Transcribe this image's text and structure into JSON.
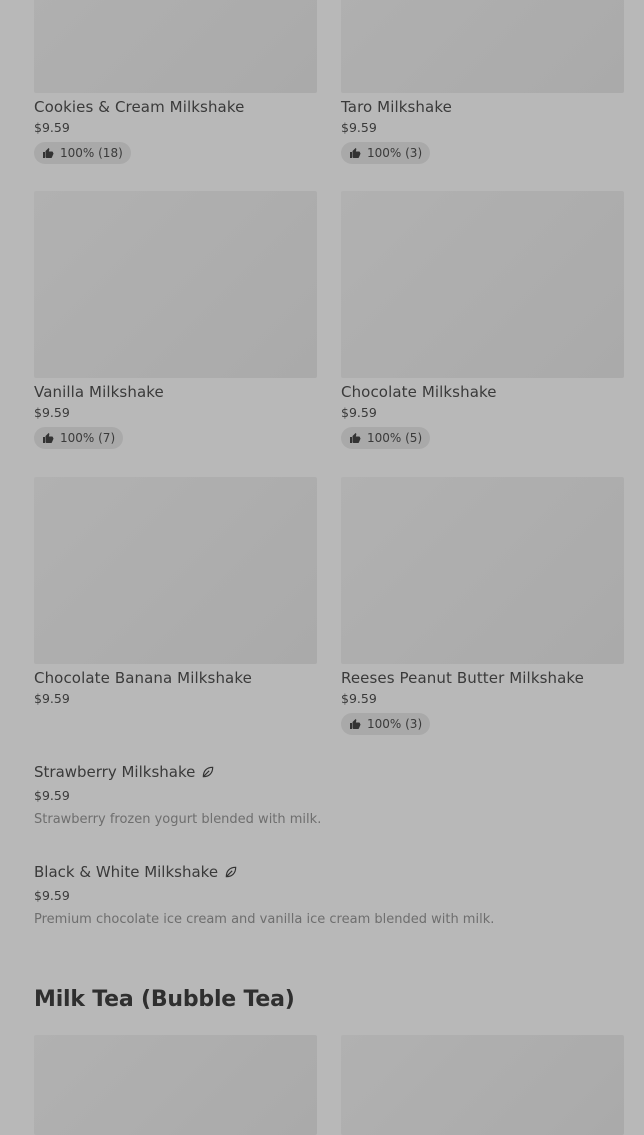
{
  "products_top": [
    {
      "name": "Cookies & Cream Milkshake",
      "price": "$9.59",
      "rating": "100% (18)"
    },
    {
      "name": "Taro Milkshake",
      "price": "$9.59",
      "rating": "100% (3)"
    },
    {
      "name": "Vanilla Milkshake",
      "price": "$9.59",
      "rating": "100% (7)"
    },
    {
      "name": "Chocolate Milkshake",
      "price": "$9.59",
      "rating": "100% (5)"
    },
    {
      "name": "Chocolate Banana Milkshake",
      "price": "$9.59",
      "rating": ""
    },
    {
      "name": "Reeses Peanut Butter Milkshake",
      "price": "$9.59",
      "rating": "100% (3)"
    }
  ],
  "list_items": [
    {
      "name": "Strawberry Milkshake",
      "price": "$9.59",
      "description": "Strawberry frozen yogurt blended with milk.",
      "icon": "leaf-icon"
    },
    {
      "name": "Black & White Milkshake",
      "price": "$9.59",
      "description": "Premium chocolate ice cream and vanilla ice cream blended with milk.",
      "icon": "leaf-icon"
    }
  ],
  "section": {
    "title": "Milk Tea (Bubble Tea)"
  },
  "colors": {
    "background": "#b8b8b8",
    "thumb": "#aeaeae",
    "badge": "#a9a9a9",
    "text": "#3a3a3a"
  }
}
